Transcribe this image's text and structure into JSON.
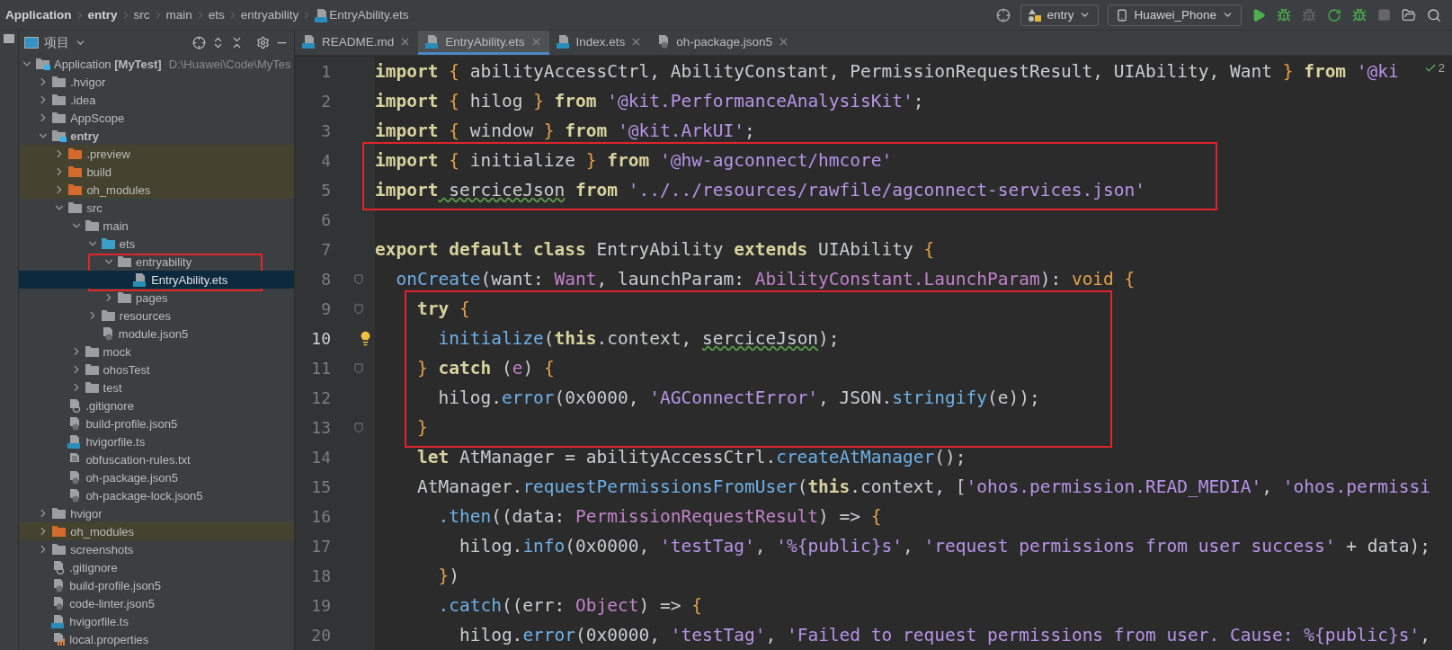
{
  "breadcrumbs": [
    {
      "text": "Application",
      "bold": true
    },
    {
      "text": "entry",
      "bold": true
    },
    {
      "text": "src",
      "bold": false
    },
    {
      "text": "main",
      "bold": false
    },
    {
      "text": "ets",
      "bold": false
    },
    {
      "text": "entryability",
      "bold": false
    },
    {
      "text": "EntryAbility.ets",
      "bold": false,
      "kind": "ets"
    }
  ],
  "run_toolbar": {
    "module": "entry",
    "device": "Huawei_Phone"
  },
  "project_panel": {
    "title": "项目",
    "tree": [
      {
        "name": "Application **[MyTest]**",
        "path": "D:\\Huawei\\Code\\MyTes",
        "kind": "module",
        "expanded": true,
        "selected": false,
        "children": [
          {
            "name": ".hvigor",
            "kind": "folder",
            "expanded": false,
            "selected": false
          },
          {
            "name": ".idea",
            "kind": "folder",
            "expanded": false,
            "selected": false
          },
          {
            "name": "AppScope",
            "kind": "folder",
            "expanded": false,
            "selected": false
          },
          {
            "name": "entry",
            "bold": true,
            "kind": "module",
            "expanded": true,
            "selected": false,
            "children": [
              {
                "name": ".preview",
                "kind": "excluded",
                "excluded": true,
                "expanded": false,
                "selected": false
              },
              {
                "name": "build",
                "kind": "excluded",
                "excluded": true,
                "expanded": false,
                "selected": false
              },
              {
                "name": "oh_modules",
                "kind": "excluded",
                "excluded": true,
                "expanded": false,
                "selected": false
              },
              {
                "name": "src",
                "kind": "folder",
                "expanded": true,
                "selected": false,
                "children": [
                  {
                    "name": "main",
                    "kind": "folder",
                    "expanded": true,
                    "selected": false,
                    "children": [
                      {
                        "name": "ets",
                        "kind": "source",
                        "expanded": true,
                        "selected": false,
                        "children": [
                          {
                            "name": "entryability",
                            "kind": "folder",
                            "expanded": true,
                            "selected": false,
                            "boxed": true,
                            "children": [
                              {
                                "name": "EntryAbility.ets",
                                "kind": "ets",
                                "selected": true
                              }
                            ]
                          },
                          {
                            "name": "pages",
                            "kind": "folder",
                            "expanded": false,
                            "selected": false
                          }
                        ]
                      },
                      {
                        "name": "resources",
                        "kind": "folder",
                        "expanded": false,
                        "selected": false
                      },
                      {
                        "name": "module.json5",
                        "kind": "json",
                        "selected": false
                      }
                    ]
                  },
                  {
                    "name": "mock",
                    "kind": "folder",
                    "expanded": false,
                    "selected": false
                  },
                  {
                    "name": "ohosTest",
                    "kind": "folder",
                    "expanded": false,
                    "selected": false
                  },
                  {
                    "name": "test",
                    "kind": "folder",
                    "expanded": false,
                    "selected": false
                  }
                ]
              },
              {
                "name": ".gitignore",
                "kind": "ignore",
                "selected": false
              },
              {
                "name": "build-profile.json5",
                "kind": "json",
                "selected": false
              },
              {
                "name": "hvigorfile.ts",
                "kind": "ts",
                "selected": false
              },
              {
                "name": "obfuscation-rules.txt",
                "kind": "text",
                "selected": false
              },
              {
                "name": "oh-package.json5",
                "kind": "json",
                "selected": false
              },
              {
                "name": "oh-package-lock.json5",
                "kind": "json",
                "selected": false
              }
            ]
          },
          {
            "name": "hvigor",
            "kind": "folder",
            "expanded": false,
            "selected": false
          },
          {
            "name": "oh_modules",
            "kind": "excluded",
            "excluded": true,
            "expanded": false,
            "selected": false
          },
          {
            "name": "screenshots",
            "kind": "folder",
            "expanded": false,
            "selected": false
          },
          {
            "name": ".gitignore",
            "kind": "ignore",
            "selected": false
          },
          {
            "name": "build-profile.json5",
            "kind": "json",
            "selected": false
          },
          {
            "name": "code-linter.json5",
            "kind": "json",
            "selected": false
          },
          {
            "name": "hvigorfile.ts",
            "kind": "ts",
            "selected": false
          },
          {
            "name": "local.properties",
            "kind": "properties",
            "selected": false
          }
        ]
      }
    ]
  },
  "tabs": [
    {
      "label": "README.md",
      "kind": "md",
      "selected": false
    },
    {
      "label": "EntryAbility.ets",
      "kind": "ets",
      "selected": true
    },
    {
      "label": "Index.ets",
      "kind": "ets",
      "selected": false
    },
    {
      "label": "oh-package.json5",
      "kind": "json",
      "selected": false
    }
  ],
  "editor": {
    "inspections": "2",
    "blocks": [
      {
        "boxed": false,
        "lines": [
          {
            "number": "1",
            "tokens": [
              {
                "kind": "keyword",
                "text": "import"
              },
              {
                "kind": "brace",
                "text": " {"
              },
              {
                "kind": "plain",
                "text": " abilityAccessCtrl, AbilityConstant, PermissionRequestResult, UIAbility, Want"
              },
              {
                "kind": "brace",
                "text": " }"
              },
              {
                "kind": "keyword",
                "text": " from"
              },
              {
                "kind": "string",
                "text": " '@ki"
              }
            ]
          },
          {
            "number": "2",
            "tokens": [
              {
                "kind": "keyword",
                "text": "import"
              },
              {
                "kind": "brace",
                "text": " {"
              },
              {
                "kind": "plain",
                "text": " hilog"
              },
              {
                "kind": "brace",
                "text": " }"
              },
              {
                "kind": "keyword",
                "text": " from"
              },
              {
                "kind": "string",
                "text": " '@kit.PerformanceAnalysisKit'"
              },
              {
                "kind": "plain",
                "text": ";"
              }
            ]
          },
          {
            "number": "3",
            "tokens": [
              {
                "kind": "keyword",
                "text": "import"
              },
              {
                "kind": "brace",
                "text": " {"
              },
              {
                "kind": "plain",
                "text": " window"
              },
              {
                "kind": "brace",
                "text": " }"
              },
              {
                "kind": "keyword",
                "text": " from"
              },
              {
                "kind": "string",
                "text": " '@kit.ArkUI'"
              },
              {
                "kind": "plain",
                "text": ";"
              }
            ]
          }
        ]
      },
      {
        "boxed": true,
        "lines": [
          {
            "number": "4",
            "tokens": [
              {
                "kind": "keyword",
                "text": "import"
              },
              {
                "kind": "brace",
                "text": " {"
              },
              {
                "kind": "plain",
                "text": " initialize"
              },
              {
                "kind": "brace",
                "text": " }"
              },
              {
                "kind": "keyword",
                "text": " from"
              },
              {
                "kind": "string",
                "text": " '@hw-agconnect/hmcore'"
              }
            ]
          },
          {
            "number": "5",
            "tokens": [
              {
                "kind": "keyword",
                "text": "import"
              },
              {
                "kind": "typo",
                "text": " serciceJson"
              },
              {
                "kind": "keyword",
                "text": " from"
              },
              {
                "kind": "string",
                "text": " '../../resources/rawfile/agconnect-services.json'"
              }
            ]
          }
        ]
      },
      {
        "boxed": false,
        "lines": [
          {
            "number": "6"
          },
          {
            "number": "7",
            "tokens": [
              {
                "kind": "keyword",
                "text": "export default class"
              },
              {
                "kind": "plain",
                "text": " EntryAbility"
              },
              {
                "kind": "keyword",
                "text": " extends"
              },
              {
                "kind": "plain",
                "text": " UIAbility"
              },
              {
                "kind": "brace",
                "text": " {"
              }
            ]
          },
          {
            "number": "8",
            "fold": true,
            "tokens": [
              {
                "kind": "call",
                "text": "  onCreate"
              },
              {
                "kind": "plain",
                "text": "(want: "
              },
              {
                "kind": "type",
                "text": "Want"
              },
              {
                "kind": "plain",
                "text": ", launchParam: "
              },
              {
                "kind": "type",
                "text": "AbilityConstant.LaunchParam"
              },
              {
                "kind": "plain",
                "text": "): "
              },
              {
                "kind": "brace",
                "text": "void {"
              }
            ]
          }
        ]
      },
      {
        "boxed": true,
        "lines": [
          {
            "number": "9",
            "fold": true,
            "tokens": [
              {
                "kind": "keyword",
                "text": "    try"
              },
              {
                "kind": "brace",
                "text": " {"
              }
            ]
          },
          {
            "number": "10",
            "current": true,
            "tokens": [
              {
                "kind": "call",
                "text": "      initialize"
              },
              {
                "kind": "plain",
                "text": "("
              },
              {
                "kind": "keyword",
                "text": "this"
              },
              {
                "kind": "plain",
                "text": ".context, "
              },
              {
                "kind": "typo",
                "text": "serciceJson"
              },
              {
                "kind": "plain",
                "text": ");"
              }
            ]
          },
          {
            "number": "11",
            "fold": true,
            "tokens": [
              {
                "kind": "brace",
                "text": "    }"
              },
              {
                "kind": "keyword",
                "text": " catch"
              },
              {
                "kind": "plain",
                "text": " ("
              },
              {
                "kind": "type",
                "text": "e"
              },
              {
                "kind": "plain",
                "text": ")"
              },
              {
                "kind": "brace",
                "text": " {"
              }
            ]
          },
          {
            "number": "12",
            "tokens": [
              {
                "kind": "plain",
                "text": "      hilog."
              },
              {
                "kind": "call",
                "text": "error"
              },
              {
                "kind": "plain",
                "text": "(0x0000, "
              },
              {
                "kind": "string",
                "text": "'AGConnectError'"
              },
              {
                "kind": "plain",
                "text": ", JSON."
              },
              {
                "kind": "call",
                "text": "stringify"
              },
              {
                "kind": "plain",
                "text": "(e));"
              }
            ]
          },
          {
            "number": "13",
            "fold": true,
            "tokens": [
              {
                "kind": "brace",
                "text": "    }"
              }
            ]
          }
        ]
      },
      {
        "boxed": false,
        "lines": [
          {
            "number": "14",
            "tokens": [
              {
                "kind": "keyword",
                "text": "    let"
              },
              {
                "kind": "plain",
                "text": " AtManager = abilityAccessCtrl."
              },
              {
                "kind": "call",
                "text": "createAtManager"
              },
              {
                "kind": "plain",
                "text": "();"
              }
            ]
          },
          {
            "number": "15",
            "tokens": [
              {
                "kind": "plain",
                "text": "    AtManager."
              },
              {
                "kind": "call",
                "text": "requestPermissionsFromUser"
              },
              {
                "kind": "plain",
                "text": "("
              },
              {
                "kind": "keyword",
                "text": "this"
              },
              {
                "kind": "plain",
                "text": ".context, ["
              },
              {
                "kind": "string",
                "text": "'ohos.permission.READ_MEDIA'"
              },
              {
                "kind": "plain",
                "text": ", "
              },
              {
                "kind": "string",
                "text": "'ohos.permissi"
              }
            ]
          },
          {
            "number": "16",
            "tokens": [
              {
                "kind": "call",
                "text": "      .then"
              },
              {
                "kind": "plain",
                "text": "((data: "
              },
              {
                "kind": "type",
                "text": "PermissionRequestResult"
              },
              {
                "kind": "plain",
                "text": ") =>"
              },
              {
                "kind": "brace",
                "text": " {"
              }
            ]
          },
          {
            "number": "17",
            "tokens": [
              {
                "kind": "plain",
                "text": "        hilog."
              },
              {
                "kind": "call",
                "text": "info"
              },
              {
                "kind": "plain",
                "text": "(0x0000, "
              },
              {
                "kind": "string",
                "text": "'testTag'"
              },
              {
                "kind": "plain",
                "text": ", "
              },
              {
                "kind": "string",
                "text": "'%{public}s'"
              },
              {
                "kind": "plain",
                "text": ", "
              },
              {
                "kind": "string",
                "text": "'request permissions from user success'"
              },
              {
                "kind": "plain",
                "text": " + data);"
              }
            ]
          },
          {
            "number": "18",
            "tokens": [
              {
                "kind": "brace",
                "text": "      }"
              },
              {
                "kind": "plain",
                "text": ")"
              }
            ]
          },
          {
            "number": "19",
            "tokens": [
              {
                "kind": "call",
                "text": "      .catch"
              },
              {
                "kind": "plain",
                "text": "((err: "
              },
              {
                "kind": "type",
                "text": "Object"
              },
              {
                "kind": "plain",
                "text": ") =>"
              },
              {
                "kind": "brace",
                "text": " {"
              }
            ]
          },
          {
            "number": "20",
            "tokens": [
              {
                "kind": "plain",
                "text": "        hilog."
              },
              {
                "kind": "call",
                "text": "error"
              },
              {
                "kind": "plain",
                "text": "(0x0000, "
              },
              {
                "kind": "string",
                "text": "'testTag'"
              },
              {
                "kind": "plain",
                "text": ", "
              },
              {
                "kind": "string",
                "text": "'Failed to request permissions from user. Cause: %{public}s'"
              },
              {
                "kind": "plain",
                "text": ","
              }
            ]
          }
        ]
      }
    ]
  }
}
